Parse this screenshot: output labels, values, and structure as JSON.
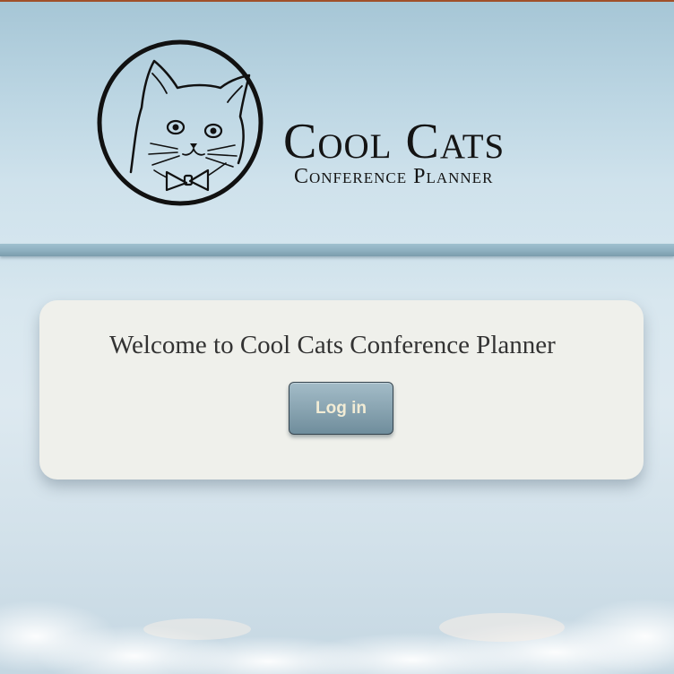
{
  "header": {
    "logo": {
      "title": "Cool Cats",
      "subtitle": "Conference Planner",
      "emblem": "cat-with-bowtie-icon"
    }
  },
  "welcome": {
    "heading": "Welcome to Cool Cats Conference Planner",
    "login_label": "Log in"
  },
  "colors": {
    "top_strip": "#a0502a",
    "card_background": "#eff0eb",
    "button_text": "#f2ecd5",
    "button_gradient_top": "#a3bcc8",
    "button_gradient_bottom": "#6f8d9c",
    "header_rule": "#8fb1c1"
  }
}
